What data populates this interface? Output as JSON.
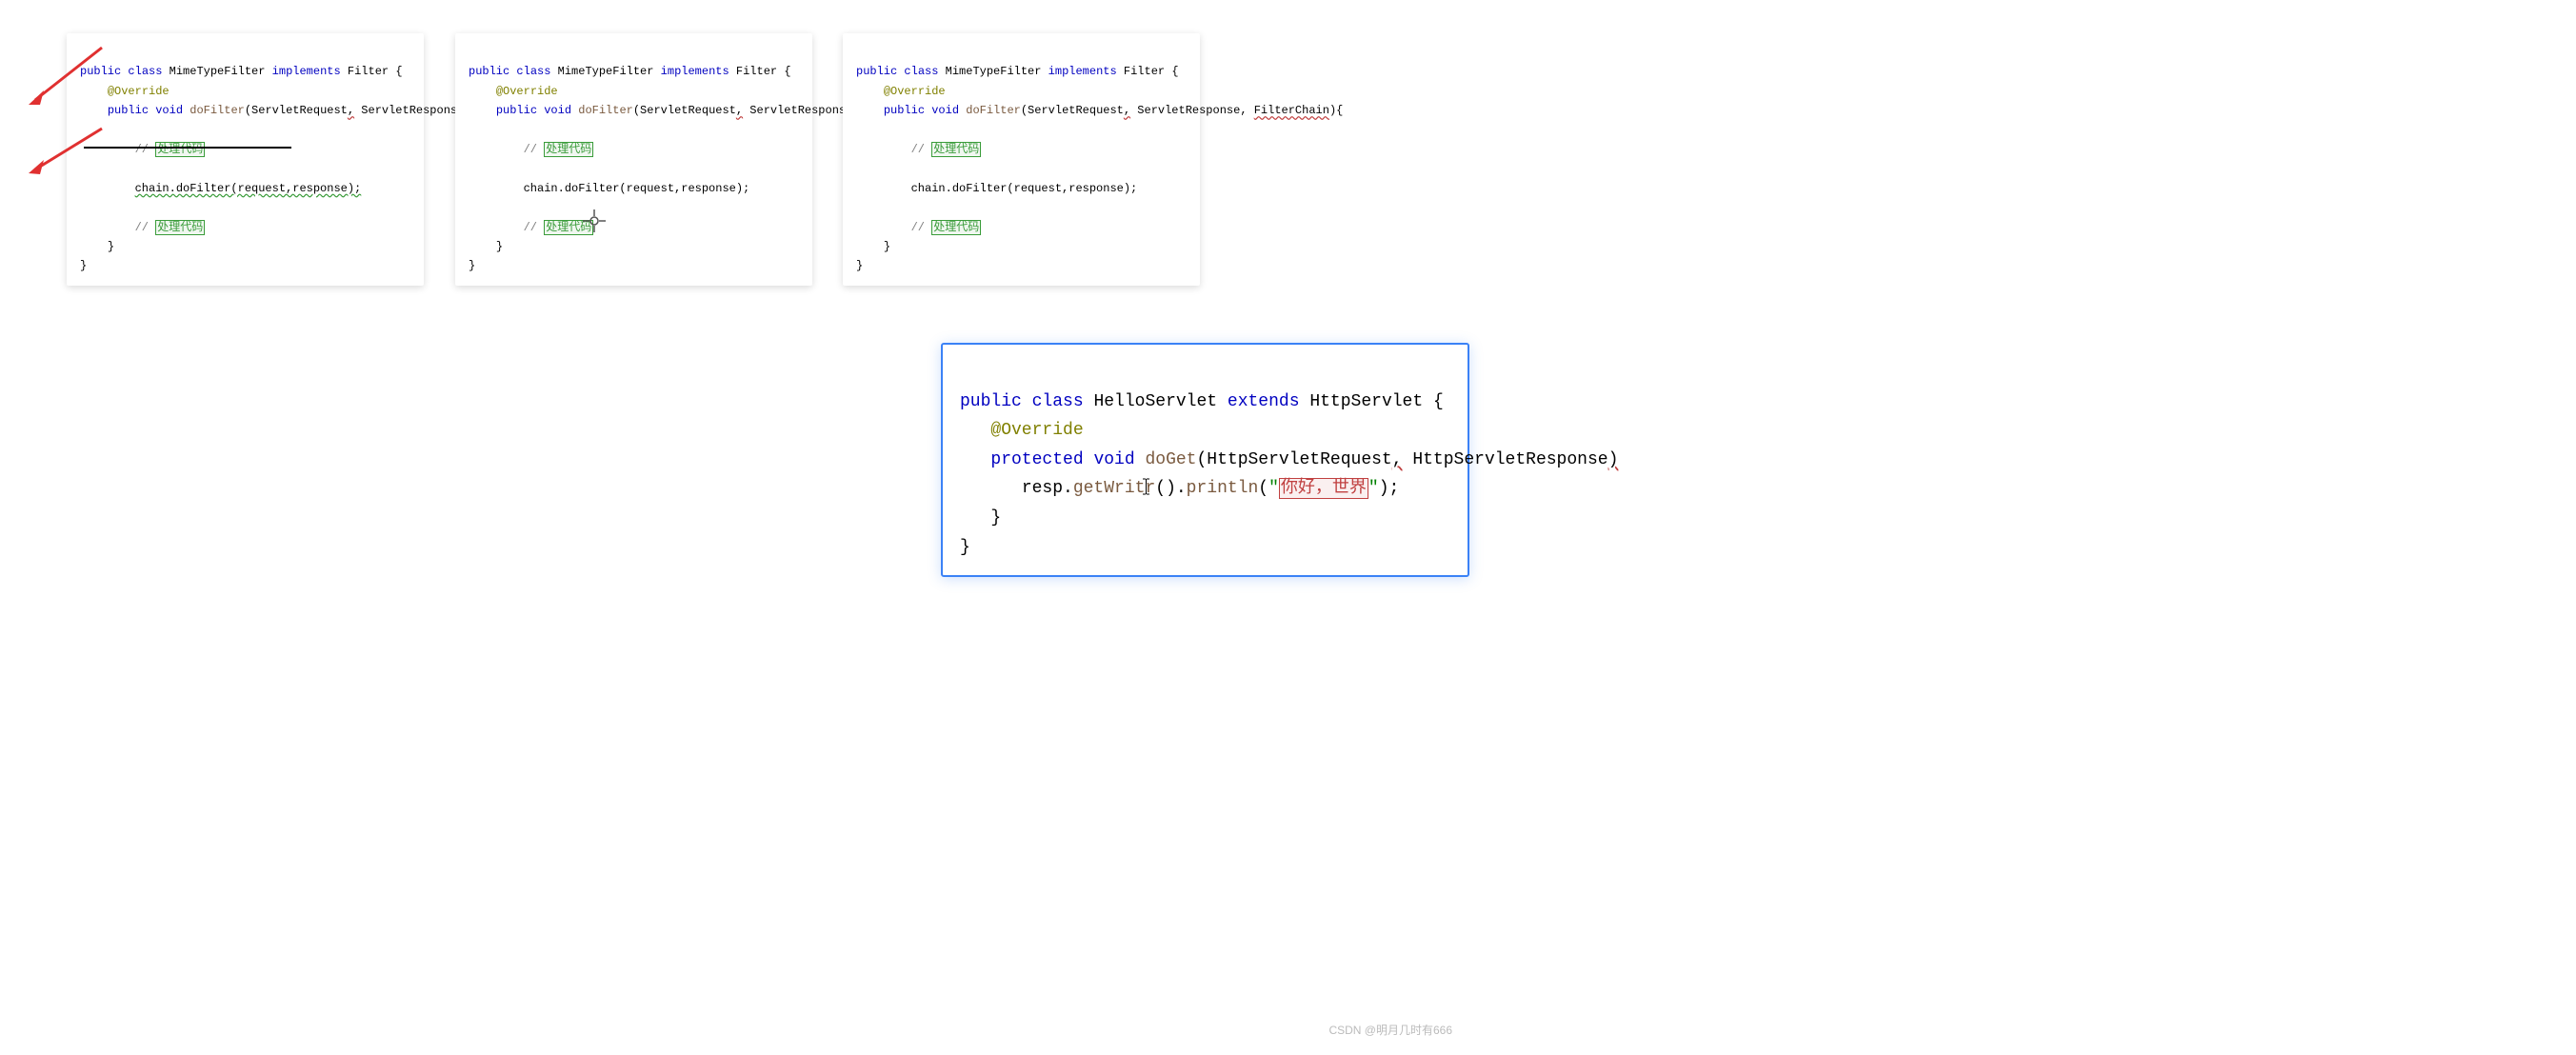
{
  "filter_code": {
    "line1": {
      "kw1": "public",
      "kw2": "class",
      "name": "MimeTypeFilter",
      "kw3": "implements",
      "iface": "Filter",
      "brace": "{"
    },
    "line2": {
      "ann": "@Override"
    },
    "line3": {
      "kw1": "public",
      "kw2": "void",
      "fn": "doFilter",
      "p1": "(ServletRequest",
      "c1": ",",
      "p2": " ServletResponse, ",
      "p3": "FilterChain",
      "c2": "){"
    },
    "line4_cm": "// ",
    "line4_hl": "处理代码",
    "line5_struck": "chain.doFilter(request,response);",
    "line5_normal": "chain.doFilter(request,response);",
    "line6_cm": "// ",
    "line6_hl": "处理代码",
    "line7": "}",
    "line8": "}"
  },
  "servlet_code": {
    "l1": {
      "kw1": "public",
      "kw2": "class",
      "name": "HelloServlet",
      "kw3": "extends",
      "sup": "HttpServlet",
      "b": "{"
    },
    "l2": {
      "ann": "@Override"
    },
    "l3": {
      "kw1": "protected",
      "kw2": "void",
      "fn": "doGet",
      "p1": "(HttpServletRequest",
      "c1": ",",
      "p2": " HttpServletResponse",
      "c2": ")"
    },
    "l4": {
      "a": "resp.",
      "b": "getWrit",
      "c": "r",
      "d": "().",
      "e": "println",
      "f": "(",
      "q": "\"",
      "s1": "你好，世界",
      "q2": "\"",
      "g": ");"
    },
    "l5": "}",
    "l6": "}"
  },
  "watermark": "CSDN @明月几时有666"
}
